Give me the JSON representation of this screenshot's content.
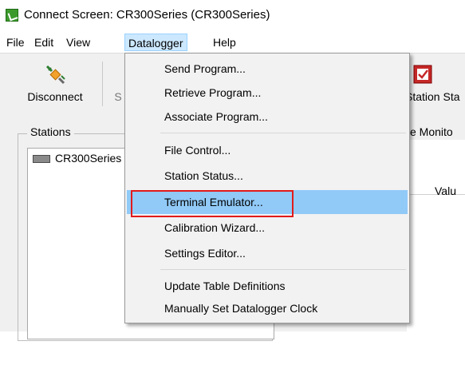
{
  "window": {
    "title": "Connect Screen: CR300Series (CR300Series)"
  },
  "menubar": {
    "items": [
      {
        "label": "File"
      },
      {
        "label": "Edit"
      },
      {
        "label": "View"
      },
      {
        "label": "Datalogger"
      },
      {
        "label": "Help"
      }
    ]
  },
  "toolbar": {
    "disconnect_label": "Disconnect",
    "partial_label": "S",
    "station_status_label": "Station Sta"
  },
  "stations": {
    "caption": "Stations",
    "items": [
      {
        "label": "CR300Series"
      }
    ]
  },
  "right_panel": {
    "monitor_tab": "e Monito",
    "value_header": "Valu"
  },
  "dropdown": {
    "items": [
      {
        "label": "Send Program..."
      },
      {
        "label": "Retrieve Program..."
      },
      {
        "label": "Associate Program..."
      },
      {
        "label": "File Control..."
      },
      {
        "label": "Station Status..."
      },
      {
        "label": "Terminal Emulator...",
        "highlighted": true
      },
      {
        "label": "Calibration Wizard..."
      },
      {
        "label": "Settings Editor..."
      },
      {
        "label": "Update Table Definitions"
      },
      {
        "label": "Manually Set Datalogger Clock"
      }
    ]
  },
  "colors": {
    "highlight": "#91c9f7",
    "annotation_box": "#e21b1b",
    "active_menu": "#cce8ff"
  }
}
